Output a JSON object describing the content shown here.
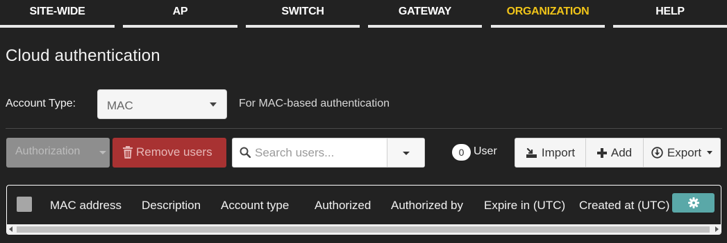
{
  "nav": {
    "tabs": [
      {
        "label": "SITE-WIDE",
        "active": false
      },
      {
        "label": "AP",
        "active": false
      },
      {
        "label": "SWITCH",
        "active": false
      },
      {
        "label": "GATEWAY",
        "active": false
      },
      {
        "label": "ORGANIZATION",
        "active": true
      },
      {
        "label": "HELP",
        "active": false
      }
    ]
  },
  "page": {
    "title": "Cloud authentication"
  },
  "account_type": {
    "label": "Account Type:",
    "selected": "MAC",
    "hint": "For MAC-based authentication"
  },
  "toolbar": {
    "authorization_label": "Authorization",
    "remove_users_label": "Remove users",
    "search_placeholder": "Search users...",
    "user_count": "0",
    "user_label": "User",
    "import_label": "Import",
    "add_label": "Add",
    "export_label": "Export"
  },
  "table": {
    "columns": [
      "MAC address",
      "Description",
      "Account type",
      "Authorized",
      "Authorized by",
      "Expire in (UTC)",
      "Created at (UTC)"
    ]
  },
  "colors": {
    "accent_active_tab": "#f0c419",
    "remove_button": "#a83232",
    "settings_button": "#5aa8a8"
  }
}
